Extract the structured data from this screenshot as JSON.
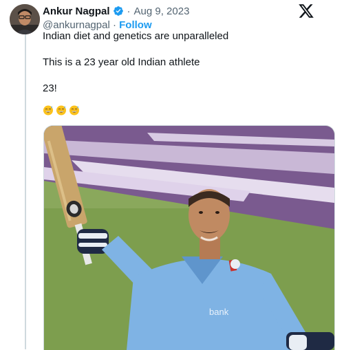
{
  "tweet": {
    "author_name": "Ankur Nagpal",
    "separator": "·",
    "date": "Aug 9, 2023",
    "handle": "@ankurnagpal",
    "handle_separator": " · ",
    "follow_label": "Follow",
    "lines": [
      "Indian diet and genetics are unparalleled",
      "This is a 23 year old Indian athlete",
      "23!"
    ],
    "emojis": [
      "grinning-face-with-sweat",
      "grinning-face-with-sweat",
      "grinning-face-with-sweat"
    ],
    "media_alt": "Cricketer in light blue kit raising his bat",
    "media_jersey_text": "bank"
  },
  "colors": {
    "verified": "#1d9bf0",
    "link": "#1d9bf0",
    "secondary_text": "#536471",
    "jersey": "#7fb3e4"
  },
  "icons": {
    "platform_logo": "x-logo-icon",
    "verified_badge": "verified-badge-icon"
  }
}
